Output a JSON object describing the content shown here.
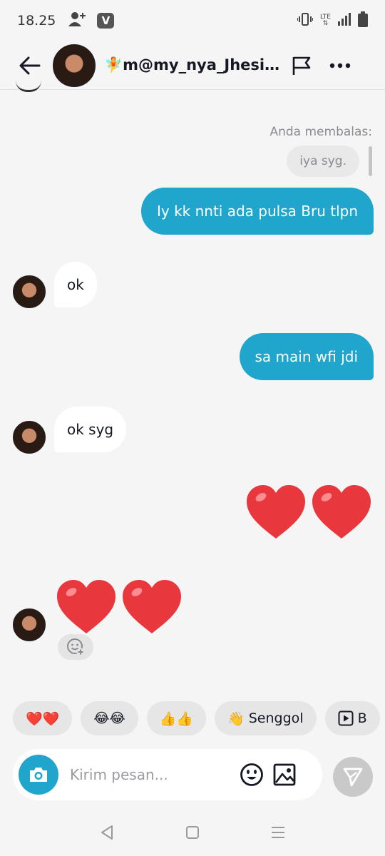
{
  "status_bar": {
    "time": "18.25",
    "network_label": "LTE"
  },
  "header": {
    "title_emoji": "🧚",
    "title": "m@my_nya_Jhesica"
  },
  "chat": {
    "reply_label": "Anda membalas:",
    "reply_quote": "iya syg.",
    "messages": [
      {
        "from": "me",
        "text": "Iy kk nnti ada pulsa Bru tlpn"
      },
      {
        "from": "them",
        "text": "ok"
      },
      {
        "from": "me",
        "text": "sa main wfi jdi"
      },
      {
        "from": "them",
        "text": "ok syg"
      },
      {
        "from": "me",
        "text": "❤❤"
      },
      {
        "from": "them",
        "text": "❤❤"
      }
    ]
  },
  "quick_replies": [
    {
      "icon": "",
      "label": "❤️❤️"
    },
    {
      "icon": "",
      "label": "😂😂"
    },
    {
      "icon": "",
      "label": "👍👍"
    },
    {
      "icon": "👋",
      "label": "Senggol"
    },
    {
      "icon": "play-icon",
      "label": "B"
    }
  ],
  "composer": {
    "placeholder": "Kirim pesan..."
  },
  "colors": {
    "accent": "#20a5cd",
    "background": "#f5f5f5",
    "heart": "#e8383d"
  }
}
